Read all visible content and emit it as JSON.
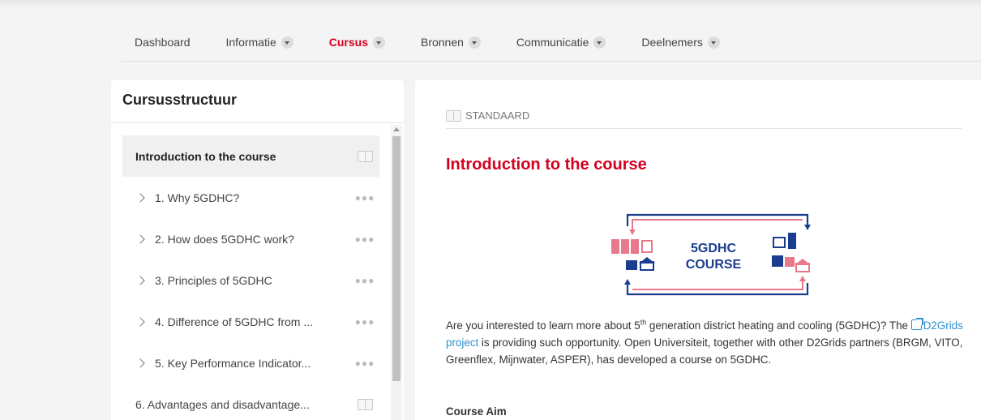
{
  "nav": {
    "items": [
      {
        "label": "Dashboard",
        "dropdown": false,
        "active": false
      },
      {
        "label": "Informatie",
        "dropdown": true,
        "active": false
      },
      {
        "label": "Cursus",
        "dropdown": true,
        "active": true
      },
      {
        "label": "Bronnen",
        "dropdown": true,
        "active": false
      },
      {
        "label": "Communicatie",
        "dropdown": true,
        "active": false
      },
      {
        "label": "Deelnemers",
        "dropdown": true,
        "active": false
      }
    ]
  },
  "sidebar": {
    "title": "Cursusstructuur",
    "items": [
      {
        "label": "Introduction to the course",
        "expandable": false,
        "icon": "book-icon",
        "active": true
      },
      {
        "label": "1. Why 5GDHC?",
        "expandable": true,
        "icon": "more-icon",
        "active": false
      },
      {
        "label": "2. How does 5GDHC work?",
        "expandable": true,
        "icon": "more-icon",
        "active": false
      },
      {
        "label": "3. Principles of 5GDHC",
        "expandable": true,
        "icon": "more-icon",
        "active": false
      },
      {
        "label": "4. Difference of 5GDHC from ...",
        "expandable": true,
        "icon": "more-icon",
        "active": false
      },
      {
        "label": "5. Key Performance Indicator...",
        "expandable": true,
        "icon": "more-icon",
        "active": false
      },
      {
        "label": "6. Advantages and disadvantage...",
        "expandable": false,
        "icon": "book-icon",
        "active": false
      }
    ]
  },
  "content": {
    "type_label": "STANDAARD",
    "title": "Introduction to the course",
    "image": {
      "line1": "5GDHC",
      "line2": "COURSE"
    },
    "para_part1": "Are you interested to learn more about 5",
    "para_sup": "th",
    "para_part2": " generation district heating and cooling (5GDHC)? The ",
    "link_text": "D2Grids project",
    "para_part3": " is providing such opportunity. Open Universiteit, together with other D2Grids partners (BRGM, VITO, Greenflex, Mijnwater, ASPER), has developed a course on 5GDHC.",
    "course_aim": "Course Aim"
  },
  "colors": {
    "accent": "#d4001f",
    "link": "#2f8fcf",
    "diagram_blue": "#1a3d8f",
    "diagram_pink": "#e8798a"
  }
}
